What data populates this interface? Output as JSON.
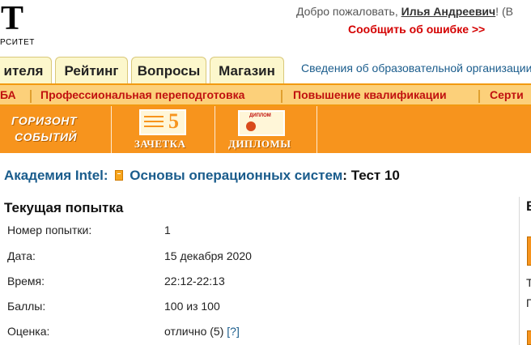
{
  "logo": {
    "letter": "T",
    "sub": "РСИТЕТ"
  },
  "header": {
    "greeting": "Добро пожаловать,",
    "user": "Илья Андреевич",
    "tail": "! (В",
    "report_link": "Сообщить об ошибке >>"
  },
  "tabs": [
    {
      "label": "ителя"
    },
    {
      "label": "Рейтинг"
    },
    {
      "label": "Вопросы"
    },
    {
      "label": "Магазин"
    }
  ],
  "info_link": "Сведения об образовательной организации",
  "nav": [
    {
      "label": "БА"
    },
    {
      "label": "Профессиональная переподготовка"
    },
    {
      "label": "Повышение квалификации"
    },
    {
      "label": "Серти"
    }
  ],
  "banner": {
    "horizon_1": "ГОРИЗОНТ",
    "horizon_2": "СОБЫТИЙ",
    "zachetka": "ЗАЧЕТКА",
    "zachetka_grade": "5",
    "diplomas": "ДИПЛОМЫ",
    "diploma_tag": "ДИПЛОМ"
  },
  "breadcrumb": {
    "academy": "Академия Intel",
    "course": "Основы операционных систем",
    "current": "Тест 10",
    "sep": ":"
  },
  "attempt": {
    "title": "Текущая попытка",
    "rows": [
      {
        "label": "Номер попытки:",
        "value": "1"
      },
      {
        "label": "Дата:",
        "value": "15 декабря 2020"
      },
      {
        "label": "Время:",
        "value": "22:12-22:13"
      },
      {
        "label": "Баллы:",
        "value": "100 из 100"
      },
      {
        "label": "Оценка:",
        "value": "отлично (5)"
      }
    ],
    "help": "[?]"
  },
  "side": {
    "head": "В",
    "t_char": "Т",
    "p_char": "П"
  },
  "colors": {
    "accent": "#f7941d",
    "link": "#1a5c8c",
    "alert": "#d40000",
    "nav_text": "#c0100f"
  }
}
